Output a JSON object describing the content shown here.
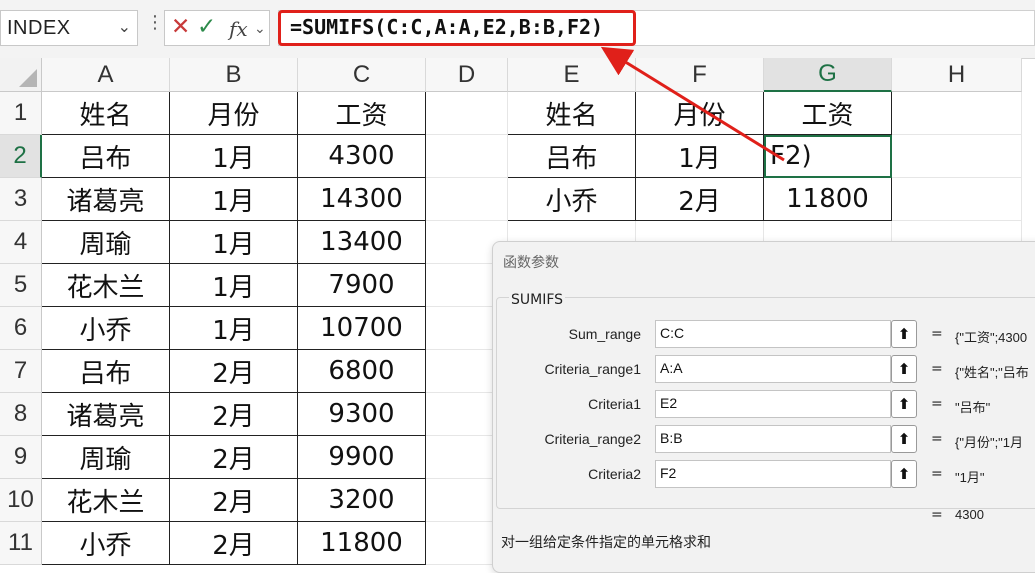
{
  "formula_bar": {
    "name_box": "INDEX",
    "formula": "=SUMIFS(C:C,A:A,E2,B:B,F2)",
    "fx_label": "fx"
  },
  "columns": [
    "A",
    "B",
    "C",
    "D",
    "E",
    "F",
    "G",
    "H"
  ],
  "rows": [
    "1",
    "2",
    "3",
    "4",
    "5",
    "6",
    "7",
    "8",
    "9",
    "10",
    "11"
  ],
  "left_table": {
    "headers": [
      "姓名",
      "月份",
      "工资"
    ],
    "rows": [
      [
        "吕布",
        "1月",
        "4300"
      ],
      [
        "诸葛亮",
        "1月",
        "14300"
      ],
      [
        "周瑜",
        "1月",
        "13400"
      ],
      [
        "花木兰",
        "1月",
        "7900"
      ],
      [
        "小乔",
        "1月",
        "10700"
      ],
      [
        "吕布",
        "2月",
        "6800"
      ],
      [
        "诸葛亮",
        "2月",
        "9300"
      ],
      [
        "周瑜",
        "2月",
        "9900"
      ],
      [
        "花木兰",
        "2月",
        "3200"
      ],
      [
        "小乔",
        "2月",
        "11800"
      ]
    ]
  },
  "right_table": {
    "headers": [
      "姓名",
      "月份",
      "工资"
    ],
    "rows": [
      [
        "吕布",
        "1月",
        "F2)"
      ],
      [
        "小乔",
        "2月",
        "11800"
      ]
    ]
  },
  "dialog": {
    "title": "函数参数",
    "function_name": "SUMIFS",
    "args": [
      {
        "label": "Sum_range",
        "value": "C:C",
        "result": "{\"工资\";4300"
      },
      {
        "label": "Criteria_range1",
        "value": "A:A",
        "result": "{\"姓名\";\"吕布"
      },
      {
        "label": "Criteria1",
        "value": "E2",
        "result": "\"吕布\""
      },
      {
        "label": "Criteria_range2",
        "value": "B:B",
        "result": "{\"月份\";\"1月"
      },
      {
        "label": "Criteria2",
        "value": "F2",
        "result": "\"1月\""
      }
    ],
    "eq": "=",
    "total": "4300",
    "description": "对一组给定条件指定的单元格求和"
  },
  "colors": {
    "highlight_red": "#e0201a",
    "selection_green": "#1e7145"
  }
}
